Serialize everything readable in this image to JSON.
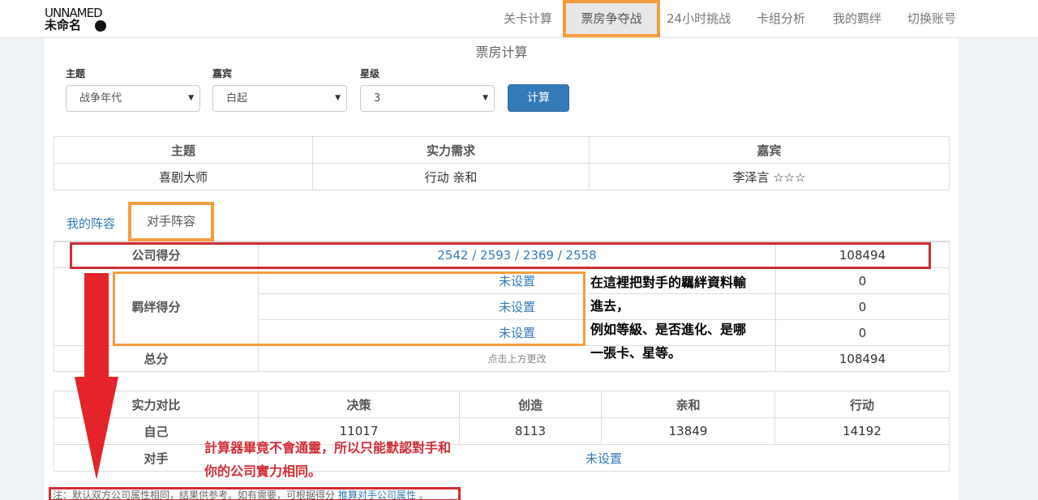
{
  "logo": {
    "line1": "UNNAMED",
    "line2": "未命名"
  },
  "nav": {
    "items": [
      "关卡计算",
      "票房争夺战",
      "24小时挑战",
      "卡组分析",
      "我的羁绊",
      "切换账号"
    ]
  },
  "page": {
    "title": "票房计算"
  },
  "form": {
    "theme_label": "主题",
    "theme_value": "战争年代",
    "guest_label": "嘉宾",
    "guest_value": "白起",
    "star_label": "星级",
    "star_value": "3",
    "calc_button": "计算"
  },
  "info_table": {
    "headers": [
      "主题",
      "实力需求",
      "嘉宾"
    ],
    "row": [
      "喜剧大师",
      "行动 亲和",
      "李泽言 ☆☆☆"
    ]
  },
  "tabs": {
    "mine": "我的阵容",
    "opponent": "对手阵容"
  },
  "score_table": {
    "company_label": "公司得分",
    "company_scores": "2542 / 2593 / 2369 / 2558",
    "company_total": "108494",
    "bond_label": "羁绊得分",
    "bond_rows": [
      {
        "value": "未设置",
        "score": "0"
      },
      {
        "value": "未设置",
        "score": "0"
      },
      {
        "value": "未设置",
        "score": "0"
      }
    ],
    "total_label": "总分",
    "total_hint": "点击上方更改",
    "total_value": "108494"
  },
  "power_table": {
    "headers": [
      "实力对比",
      "决策",
      "创造",
      "亲和",
      "行动"
    ],
    "self_label": "自己",
    "self_values": [
      "11017",
      "8113",
      "13849",
      "14192"
    ],
    "opponent_label": "对手",
    "opponent_value": "未设置"
  },
  "note": {
    "text": "注：默认双方公司属性相同，结果供参考。如有需要，可根据得分",
    "link": "推算对手公司属性",
    "tail": "。"
  },
  "annotations": {
    "bond_note": [
      "在這裡把對手的羈絆資料輸",
      "進去，",
      "例如等級、是否進化、是哪",
      "一張卡、星等。"
    ],
    "power_note": [
      "計算器畢竟不會通靈，所以只能默認對手和",
      "你的公司實力相同。"
    ],
    "colors": {
      "red": "#d12d35",
      "orange": "#f59d3e",
      "arrow": "#e4242a",
      "accent": "#337ab7"
    }
  }
}
